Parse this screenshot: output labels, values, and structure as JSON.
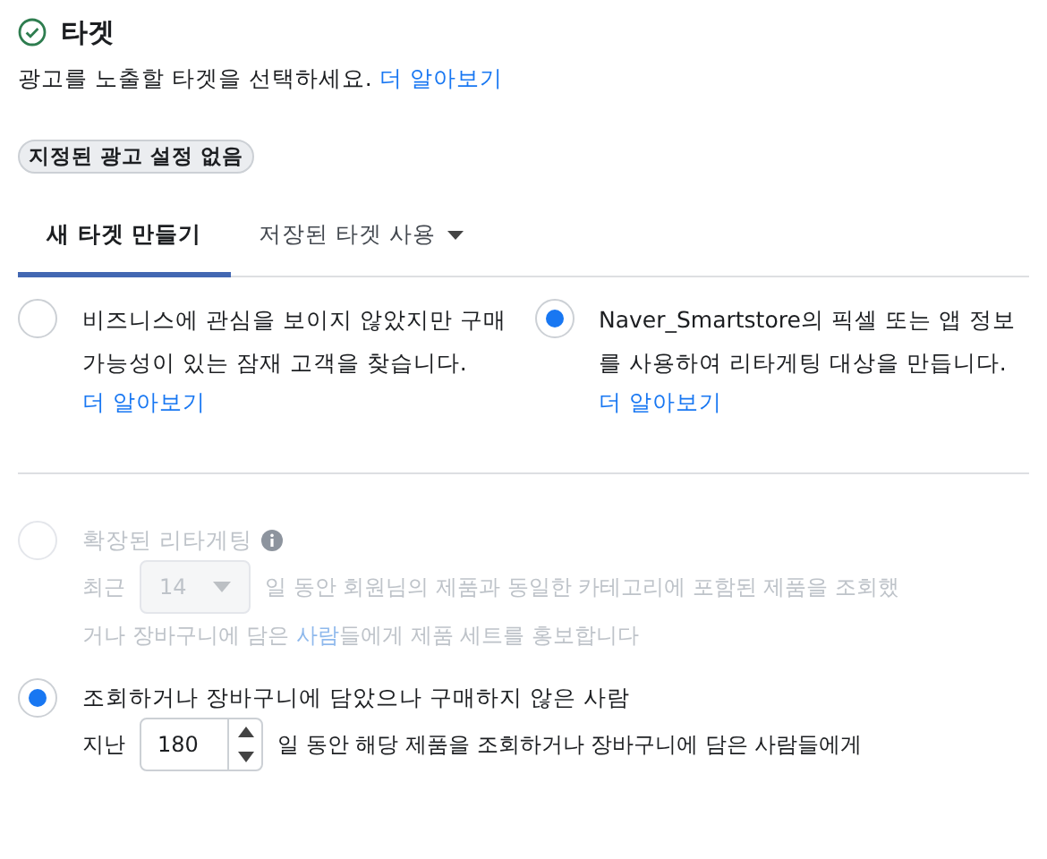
{
  "section": {
    "title": "타겟",
    "subtitle": "광고를 노출할 타겟을 선택하세요.",
    "learn_more": "더 알아보기",
    "chip": "지정된 광고 설정 없음"
  },
  "tabs": [
    {
      "label": "새 타겟 만들기",
      "selected": true,
      "dropdown": false
    },
    {
      "label": "저장된 타겟 사용",
      "selected": false,
      "dropdown": true
    }
  ],
  "choices": [
    {
      "text": "비즈니스에 관심을 보이지 않았지만 구매 가능성이 있는 잠재 고객을 찾습니다.",
      "link": "더 알아보기",
      "selected": false
    },
    {
      "text": "Naver_Smartstore의 픽셀 또는 앱 정보를 사용하여 리타게팅 대상을 만듭니다.",
      "link": "더 알아보기",
      "selected": true
    }
  ],
  "options": [
    {
      "kind": "dropdown",
      "label": "확장된 리타게팅",
      "info": true,
      "selected": false,
      "disabled": true,
      "prefix": "최근",
      "value": "14",
      "text": "일 동안 회원님의 제품과 동일한 카테고리에 포함된 제품을 조회했",
      "continuation": "거나 장바구니에 담은 ",
      "link": "사람",
      "text_after": "들에게 제품 세트를 홍보합니다"
    },
    {
      "kind": "stepper",
      "label": "조회하거나 장바구니에 담았으나 구매하지 않은 사람",
      "info": false,
      "selected": true,
      "disabled": false,
      "prefix": "지난",
      "value": "180",
      "text": "일 동안 해당 제품을 조회하거나 장바구니에 담은 사람들에게"
    }
  ]
}
